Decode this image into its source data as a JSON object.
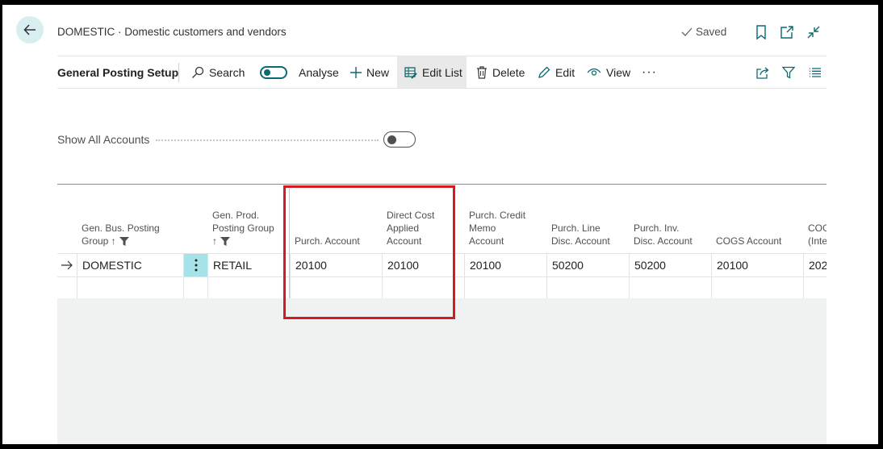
{
  "header": {
    "caption": "DOMESTIC · Domestic customers and vendors",
    "saved_label": "Saved"
  },
  "actionbar": {
    "page_title": "General Posting Setup",
    "search": "Search",
    "analyse": "Analyse",
    "new": "New",
    "edit_list": "Edit List",
    "delete": "Delete",
    "edit": "Edit",
    "view": "View",
    "more": "···"
  },
  "filter": {
    "show_all_accounts_label": "Show All Accounts"
  },
  "grid": {
    "columns": [
      {
        "line1": "Gen. Bus. Posting",
        "line2": "Group ↑"
      },
      {
        "line1": "Gen. Prod.",
        "line2": "Posting Group",
        "line3": "↑"
      },
      {
        "line1": "Purch. Account"
      },
      {
        "line1": "Direct Cost",
        "line2": "Applied",
        "line3": "Account"
      },
      {
        "line1": "Purch. Credit",
        "line2": "Memo",
        "line3": "Account"
      },
      {
        "line1": "Purch. Line",
        "line2": "Disc. Account"
      },
      {
        "line1": "Purch. Inv.",
        "line2": "Disc. Account"
      },
      {
        "line1": "COGS Account"
      },
      {
        "line1": "COG",
        "line2": "(Inte"
      }
    ],
    "rows": [
      {
        "gen_bus_posting_group": "DOMESTIC",
        "gen_prod_posting_group": "RETAIL",
        "purch_account": "20100",
        "direct_cost_applied_account": "20100",
        "purch_credit_memo_account": "20100",
        "purch_line_disc_account": "50200",
        "purch_inv_disc_account": "50200",
        "cogs_account": "20100",
        "cogs_interim": "202"
      }
    ]
  },
  "colors": {
    "accent": "#0b6a70",
    "highlight": "#d71920",
    "row_menu_bg": "#a6e3e9",
    "grid_empty_bg": "#f0f2f2"
  }
}
